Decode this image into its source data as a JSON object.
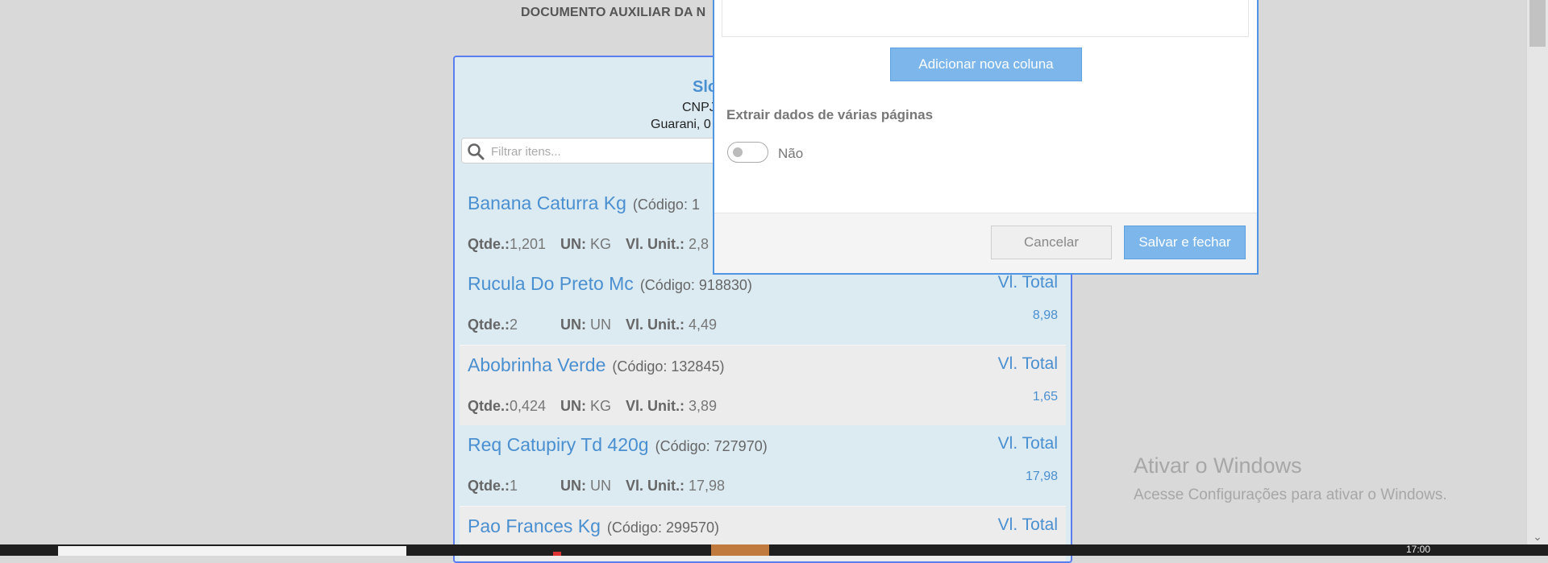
{
  "document_header": "DOCUMENTO AUXILIAR DA N",
  "store": {
    "name": "Slo",
    "cnpj": "CNPJ",
    "address": "Guarani, 0"
  },
  "search": {
    "placeholder": "Filtrar itens..."
  },
  "labels": {
    "qtde": "Qtde.:",
    "un": "UN:",
    "vl_unit": "Vl. Unit.:",
    "vl_total": "Vl. Total"
  },
  "items": [
    {
      "name": "Banana Caturra Kg",
      "code": "(Código: 1",
      "qtde": "1,201",
      "un": "KG",
      "vl_unit": "2,8",
      "vl_total": ""
    },
    {
      "name": "Rucula Do Preto Mc",
      "code": "(Código: 918830)",
      "qtde": "2",
      "un": "UN",
      "vl_unit": "4,49",
      "vl_total": "8,98"
    },
    {
      "name": "Abobrinha Verde",
      "code": "(Código: 132845)",
      "qtde": "0,424",
      "un": "KG",
      "vl_unit": "3,89",
      "vl_total": "1,65"
    },
    {
      "name": "Req Catupiry Td 420g",
      "code": "(Código: 727970)",
      "qtde": "1",
      "un": "UN",
      "vl_unit": "17,98",
      "vl_total": "17,98"
    },
    {
      "name": "Pao Frances Kg",
      "code": "(Código: 299570)",
      "qtde": "",
      "un": "",
      "vl_unit": "",
      "vl_total": ""
    }
  ],
  "modal": {
    "add_column_label": "Adicionar nova coluna",
    "extract_label": "Extrair dados de várias páginas",
    "toggle_state": "Não",
    "cancel_label": "Cancelar",
    "save_label": "Salvar e fechar"
  },
  "watermark": {
    "title": "Ativar o Windows",
    "subtitle": "Acesse Configurações para ativar o Windows."
  },
  "taskbar": {
    "time": "17:00"
  },
  "colors": {
    "accent": "#4a8fd0",
    "button_primary": "#7cb6ea",
    "receipt_bg": "#dcebf2",
    "receipt_border": "#5b7df0"
  }
}
